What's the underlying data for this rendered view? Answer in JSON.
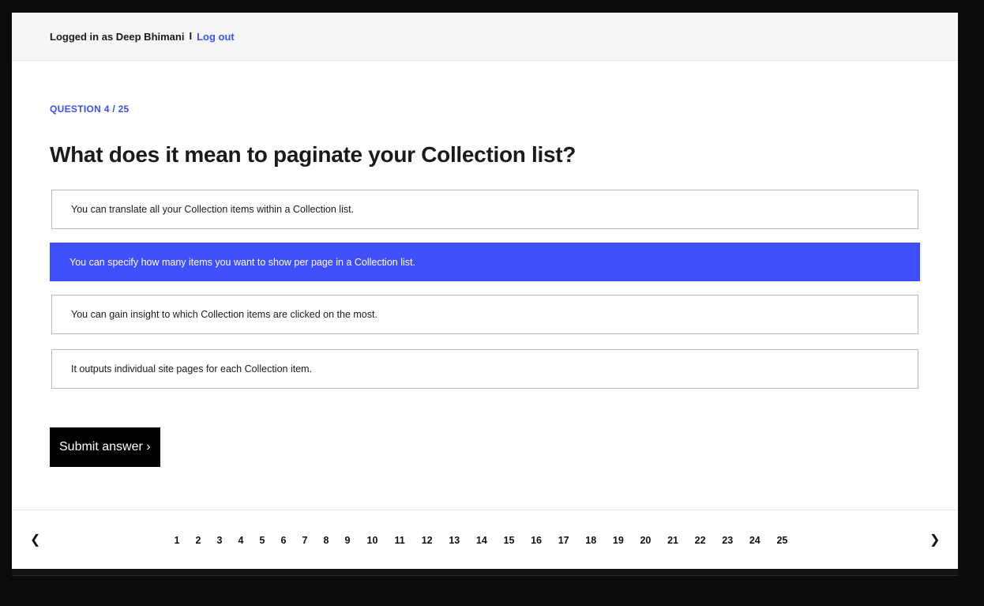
{
  "header": {
    "user_label": "Logged in as Deep Bhimani",
    "separator": "I",
    "logout_label": "Log out"
  },
  "quiz": {
    "counter": "QUESTION 4 / 25",
    "question": "What does it mean to paginate your Collection list?",
    "options": [
      {
        "label": "You can translate all your Collection items within a Collection list.",
        "selected": false
      },
      {
        "label": "You can specify how many items you want to show per page in a Collection list.",
        "selected": true
      },
      {
        "label": "You can gain insight to which Collection items are clicked on the most.",
        "selected": false
      },
      {
        "label": "It outputs individual site pages for each Collection item.",
        "selected": false
      }
    ],
    "submit_label": "Submit answer ›"
  },
  "pagination": {
    "prev_icon": "❮",
    "next_icon": "❯",
    "pages": [
      "1",
      "2",
      "3",
      "4",
      "5",
      "6",
      "7",
      "8",
      "9",
      "10",
      "11",
      "12",
      "13",
      "14",
      "15",
      "16",
      "17",
      "18",
      "19",
      "20",
      "21",
      "22",
      "23",
      "24",
      "25"
    ]
  },
  "colors": {
    "accent": "#3f50fb",
    "header_bg": "#f5f6f8"
  }
}
